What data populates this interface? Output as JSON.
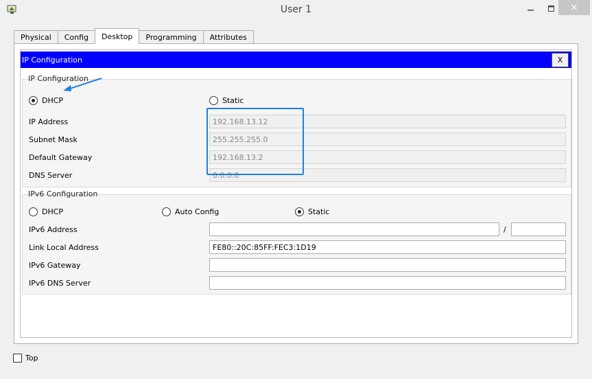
{
  "window": {
    "title": "User 1",
    "close_symbol": "×"
  },
  "tabs": [
    {
      "label": "Physical"
    },
    {
      "label": "Config"
    },
    {
      "label": "Desktop"
    },
    {
      "label": "Programming"
    },
    {
      "label": "Attributes"
    }
  ],
  "active_tab": "Desktop",
  "header": {
    "title": "IP Configuration",
    "close_label": "X"
  },
  "ipv4": {
    "group_title": "IP Configuration",
    "mode_options": {
      "dhcp": "DHCP",
      "static": "Static"
    },
    "selected_mode": "DHCP",
    "ip_address": {
      "label": "IP Address",
      "value": "192.168.13.12"
    },
    "subnet_mask": {
      "label": "Subnet Mask",
      "value": "255.255.255.0"
    },
    "default_gateway": {
      "label": "Default Gateway",
      "value": "192.168.13.2"
    },
    "dns_server": {
      "label": "DNS Server",
      "value": "0.0.0.0"
    }
  },
  "ipv6": {
    "group_title": "IPv6 Configuration",
    "mode_options": {
      "dhcp": "DHCP",
      "auto": "Auto Config",
      "static": "Static"
    },
    "selected_mode": "Static",
    "address": {
      "label": "IPv6 Address",
      "value": "",
      "prefix": "",
      "separator": "/"
    },
    "link_local": {
      "label": "Link Local Address",
      "value": "FE80::20C:85FF:FEC3:1D19"
    },
    "gateway": {
      "label": "IPv6 Gateway",
      "value": ""
    },
    "dns_server": {
      "label": "IPv6 DNS Server",
      "value": ""
    }
  },
  "footer": {
    "top_label": "Top",
    "top_checked": false
  },
  "colors": {
    "header_bar": "#0000ff",
    "highlight": "#1e7fe0"
  }
}
